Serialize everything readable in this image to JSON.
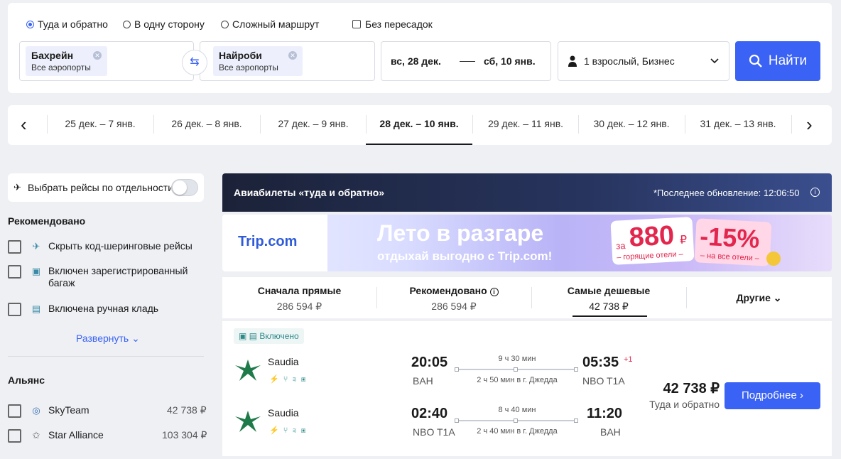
{
  "search": {
    "trip_types": [
      "Туда и обратно",
      "В одну сторону",
      "Сложный маршрут"
    ],
    "nonstop": "Без пересадок",
    "from": {
      "city": "Бахрейн",
      "sub": "Все аэропорты"
    },
    "to": {
      "city": "Найроби",
      "sub": "Все аэропорты"
    },
    "date_out": "вс, 28 дек.",
    "date_back": "сб, 10 янв.",
    "passengers": "1 взрослый, Бизнес",
    "find": "Найти"
  },
  "dates": [
    "25 дек. – 7 янв.",
    "26 дек. – 8 янв.",
    "27 дек. – 9 янв.",
    "28 дек. – 10 янв.",
    "29 дек. – 11 янв.",
    "30 дек. – 12 янв.",
    "31 дек. – 13 янв."
  ],
  "sidebar": {
    "toggle": "Выбрать рейсы по отдельности",
    "rec_title": "Рекомендовано",
    "rec_items": [
      "Скрыть код-шеринговые рейсы",
      "Включен зарегистрированный багаж",
      "Включена ручная кладь"
    ],
    "expand": "Развернуть",
    "alliance_title": "Альянс",
    "alliances": [
      {
        "name": "SkyTeam",
        "price": "42 738 ₽"
      },
      {
        "name": "Star Alliance",
        "price": "103 304 ₽"
      }
    ]
  },
  "results": {
    "header": "Авиабилеты «туда и обратно»",
    "updated": "*Последнее обновление: 12:06:50",
    "ad": {
      "brand": "Trip.com",
      "title": "Лето в разгаре",
      "subtitle": "отдыхай выгодно с Trip.com!",
      "promo1_pre": "за",
      "promo1": "880",
      "promo1_cur": "₽",
      "promo1_sub": "– горящие отели –",
      "promo2": "-15%",
      "promo2_sub": "– на все отели –"
    },
    "sort": [
      {
        "title": "Сначала прямые",
        "price": "286 594 ₽"
      },
      {
        "title": "Рекомендовано",
        "price": "286 594 ₽"
      },
      {
        "title": "Самые дешевые",
        "price": "42 738 ₽"
      },
      {
        "title": "Другие",
        "price": ""
      }
    ],
    "card": {
      "included": "Включено",
      "price": "42 738 ₽",
      "price_sub": "Туда и обратно",
      "details": "Подробнее",
      "legs": [
        {
          "airline": "Saudia",
          "dep": "20:05",
          "arr": "05:35",
          "plus": "+1",
          "from": "BAH",
          "to": "NBO T1A",
          "dur": "9 ч 30 мин",
          "stop": "2 ч 50 мин в г. Джедда"
        },
        {
          "airline": "Saudia",
          "dep": "02:40",
          "arr": "11:20",
          "plus": "",
          "from": "NBO T1A",
          "to": "BAH",
          "dur": "8 ч 40 мин",
          "stop": "2 ч 40 мин в г. Джедда"
        }
      ]
    }
  }
}
